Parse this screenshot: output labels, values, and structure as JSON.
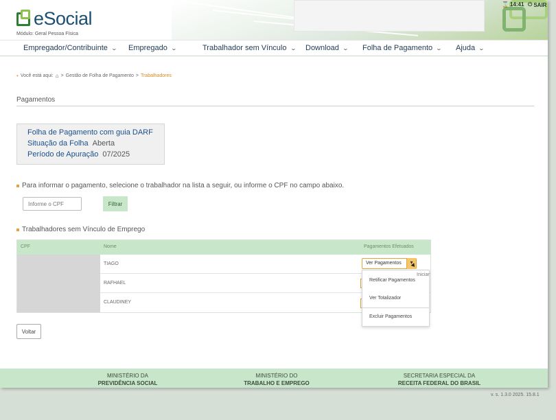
{
  "header": {
    "app_name": "eSocial",
    "module": "Módulo: Geral Pessoa Física",
    "time": "14:41",
    "exit_label": "SAIR"
  },
  "nav": {
    "items": [
      {
        "label": "Empregador/Contribuinte"
      },
      {
        "label": "Empregado"
      },
      {
        "label": "Trabalhador sem Vínculo"
      },
      {
        "label": "Download"
      },
      {
        "label": "Folha de Pagamento"
      },
      {
        "label": "Ajuda"
      }
    ]
  },
  "breadcrumb": {
    "prefix": "Você está aqui:",
    "sep": ">",
    "items": [
      "Gestão de Folha de Pagamento",
      "Trabalhadores"
    ]
  },
  "page": {
    "title": "Pagamentos"
  },
  "info": {
    "title": "Folha de Pagamento com guia DARF",
    "status_label": "Situação da Folha",
    "status_value": "Aberta",
    "period_label": "Período de Apuração",
    "period_value": "07/2025"
  },
  "filter": {
    "instruction": "Para informar o pagamento, selecione o trabalhador na lista a seguir, ou informe o CPF no campo abaixo.",
    "cpf_placeholder": "Informe o CPF",
    "button_label": "Filtrar"
  },
  "workers": {
    "title": "Trabalhadores sem Vínculo de Emprego",
    "columns": [
      "CPF",
      "Nome",
      "Pagamentos Efetuados"
    ],
    "rows": [
      {
        "name": "TIAGO"
      },
      {
        "name": "RAFHAEL"
      },
      {
        "name": "CLAUDINEY"
      }
    ],
    "action_label": "Ver Pagamentos"
  },
  "dropdown": {
    "options": [
      "Retificar Pagamentos",
      "Ver Totalizador",
      "Excluir Pagamentos"
    ],
    "tooltip": "Iniciar"
  },
  "actions": {
    "back_label": "Voltar"
  },
  "footer": {
    "items": [
      {
        "line1": "MINISTÉRIO DA",
        "line2": "PREVIDÊNCIA SOCIAL"
      },
      {
        "line1": "MINISTÉRIO DO",
        "line2": "TRABALHO E EMPREGO"
      },
      {
        "line1": "SECRETARIA ESPECIAL DA",
        "line2": "RECEITA FEDERAL DO BRASIL"
      }
    ],
    "version": "v. s. 1.3.0 2025. 15.8.1"
  },
  "colors": {
    "brand_green": "#2e7d32",
    "accent_orange": "#e6a23c",
    "table_header": "#c8e6c9",
    "nav_text": "#1f3a54"
  }
}
